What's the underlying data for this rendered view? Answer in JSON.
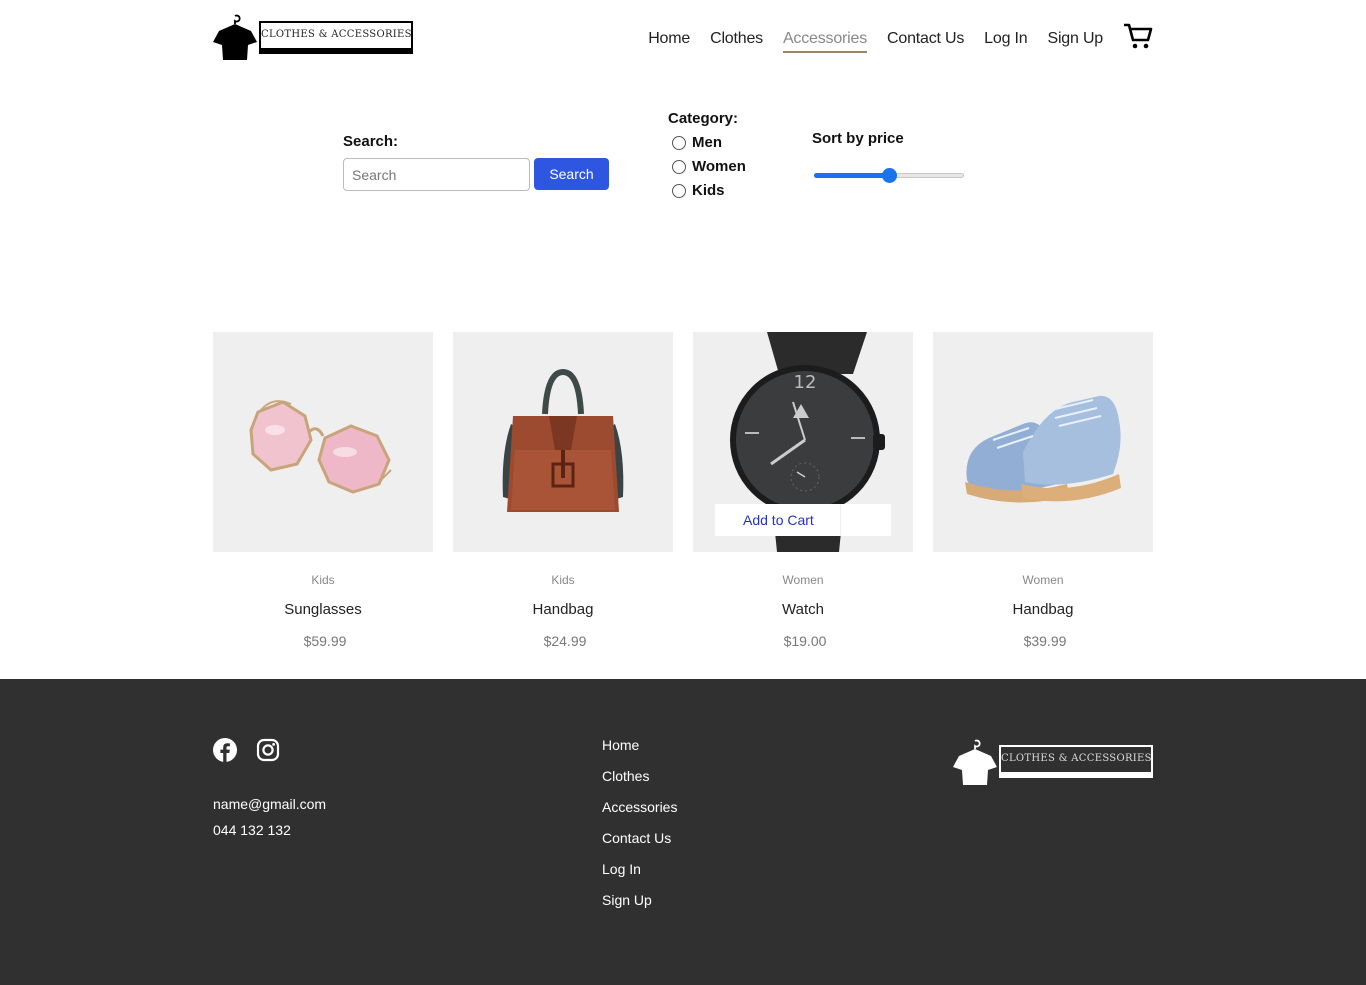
{
  "brand": {
    "logo_text": "CLOTHES & ACCESSORIES"
  },
  "nav": {
    "items": [
      {
        "label": "Home",
        "active": false
      },
      {
        "label": "Clothes",
        "active": false
      },
      {
        "label": "Accessories",
        "active": true
      },
      {
        "label": "Contact Us",
        "active": false
      },
      {
        "label": "Log In",
        "active": false
      },
      {
        "label": "Sign Up",
        "active": false
      }
    ],
    "cart_icon": "cart-icon",
    "active_underline_color": "#9a8568"
  },
  "filters": {
    "search_label": "Search:",
    "search_placeholder": "Search",
    "search_value": "",
    "search_button": "Search",
    "category_label": "Category:",
    "categories": [
      "Men",
      "Women",
      "Kids"
    ],
    "selected_category": null,
    "sort_label": "Sort by price",
    "sort_slider_fraction": 0.5
  },
  "products": [
    {
      "category": "Kids",
      "name": "Sunglasses",
      "price": "$59.99",
      "image": "sunglasses"
    },
    {
      "category": "Kids",
      "name": "Handbag",
      "price": "$24.99",
      "image": "handbag"
    },
    {
      "category": "Women",
      "name": "Watch",
      "price": "$19.00",
      "image": "watch",
      "add_to_cart": "Add to Cart"
    },
    {
      "category": "Women",
      "name": "Handbag",
      "price": "$39.99",
      "image": "sneakers"
    }
  ],
  "footer": {
    "social_icons": [
      "facebook-icon",
      "instagram-icon"
    ],
    "email": "name@gmail.com",
    "phone": "044 132 132",
    "links": [
      "Home",
      "Clothes",
      "Accessories",
      "Contact Us",
      "Log In",
      "Sign Up"
    ],
    "logo_text": "CLOTHES & ACCESSORIES"
  },
  "colors": {
    "accent": "#2f56e0",
    "slider": "#1a73e8",
    "footer_bg": "#303030",
    "card_bg": "#efefef"
  }
}
